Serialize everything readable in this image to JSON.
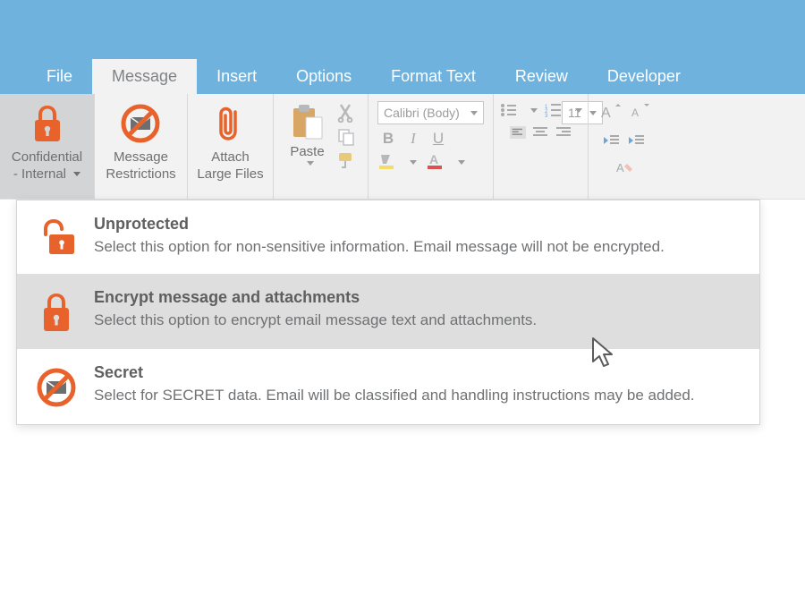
{
  "tabs": [
    "File",
    "Message",
    "Insert",
    "Options",
    "Format Text",
    "Review",
    "Developer"
  ],
  "active_tab_index": 1,
  "ribbon": {
    "confidential": {
      "label_line1": "Confidential",
      "label_line2": "- Internal"
    },
    "restrictions": {
      "label_line1": "Message",
      "label_line2": "Restrictions"
    },
    "attach": {
      "label_line1": "Attach",
      "label_line2": "Large Files"
    },
    "paste": {
      "label": "Paste"
    },
    "font_name": "Calibri (Body)",
    "font_size": "11",
    "bold": "B",
    "italic": "I",
    "underline": "U"
  },
  "dropdown": {
    "items": [
      {
        "icon": "unlocked",
        "title": "Unprotected",
        "desc": "Select this option for non-sensitive information. Email message will not be encrypted."
      },
      {
        "icon": "locked",
        "title": "Encrypt message and attachments",
        "desc": "Select this option to encrypt email message text and attachments.",
        "hover": true
      },
      {
        "icon": "secret",
        "title": "Secret",
        "desc": "Select for SECRET data. Email will be classified and handling instructions may be added."
      }
    ]
  },
  "colors": {
    "accent": "#e8622b",
    "titlebar": "#6fb2de",
    "ribbon_bg": "#f2f2f3",
    "muted": "#9fa0a2"
  }
}
